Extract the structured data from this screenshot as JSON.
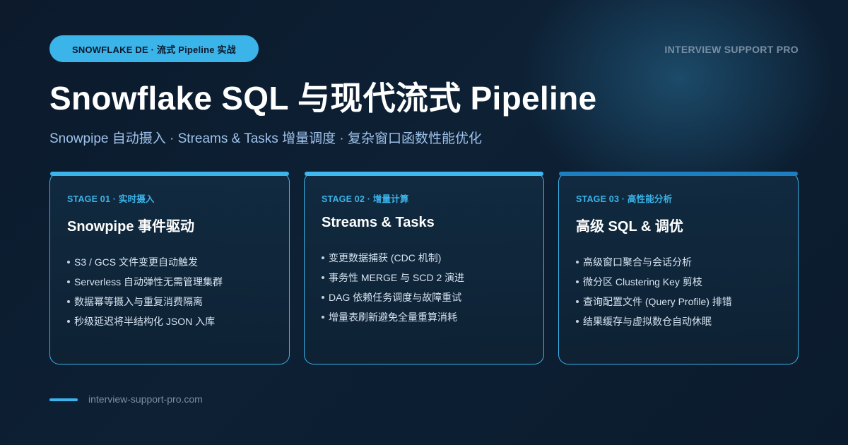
{
  "header": {
    "badge": "SNOWFLAKE DE · 流式 Pipeline 实战",
    "brand": "INTERVIEW SUPPORT PRO",
    "title": "Snowflake SQL 与现代流式 Pipeline",
    "subtitle": "Snowpipe 自动摄入 · Streams & Tasks 增量调度 · 复杂窗口函数性能优化"
  },
  "colors": {
    "accent": "#3bb4ea",
    "background": "#0d1e31",
    "muted": "#7a8ea3"
  },
  "cards": [
    {
      "stage": "STAGE 01 · 实时摄入",
      "title": "Snowpipe 事件驱动",
      "items": [
        "S3 / GCS 文件变更自动触发",
        "Serverless 自动弹性无需管理集群",
        "数据幂等摄入与重复消费隔离",
        "秒级延迟将半结构化 JSON 入库"
      ]
    },
    {
      "stage": "STAGE 02 · 增量计算",
      "title": "Streams & Tasks",
      "items": [
        "变更数据捕获 (CDC 机制)",
        "事务性 MERGE 与 SCD 2 演进",
        "DAG 依赖任务调度与故障重试",
        "增量表刷新避免全量重算消耗"
      ]
    },
    {
      "stage": "STAGE 03 · 高性能分析",
      "title": "高级 SQL & 调优",
      "items": [
        "高级窗口聚合与会话分析",
        "微分区 Clustering Key 剪枝",
        "查询配置文件 (Query Profile) 排错",
        "结果缓存与虚拟数仓自动休眠"
      ]
    }
  ],
  "footer": {
    "url": "interview-support-pro.com"
  }
}
